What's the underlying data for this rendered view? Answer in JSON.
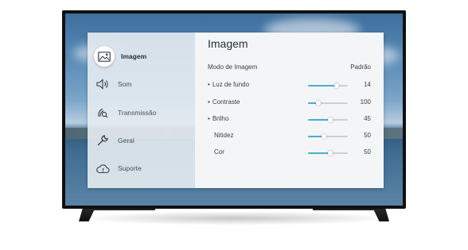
{
  "sidebar": {
    "items": [
      {
        "label": "Imagem",
        "icon": "picture-icon",
        "active": true
      },
      {
        "label": "Som",
        "icon": "speaker-icon",
        "active": false
      },
      {
        "label": "Transmissão",
        "icon": "antenna-icon",
        "active": false
      },
      {
        "label": "Geral",
        "icon": "wrench-icon",
        "active": false
      },
      {
        "label": "Suporte",
        "icon": "cloud-icon",
        "active": false
      }
    ]
  },
  "content": {
    "title": "Imagem",
    "mode": {
      "label": "Modo de Imagem",
      "value": "Padrão"
    },
    "settings": [
      {
        "label": "Luz de fundo",
        "value": "14",
        "bulleted": true,
        "slider_fraction": 0.72
      },
      {
        "label": "Contraste",
        "value": "100",
        "bulleted": true,
        "slider_fraction": 0.25
      },
      {
        "label": "Brilho",
        "value": "45",
        "bulleted": true,
        "slider_fraction": 0.56
      },
      {
        "label": "Nitidez",
        "value": "50",
        "bulleted": false,
        "slider_fraction": 0.4
      },
      {
        "label": "Cor",
        "value": "50",
        "bulleted": false,
        "slider_fraction": 0.56
      }
    ]
  },
  "colors": {
    "accent": "#4aaed0",
    "bezel": "#101010"
  }
}
